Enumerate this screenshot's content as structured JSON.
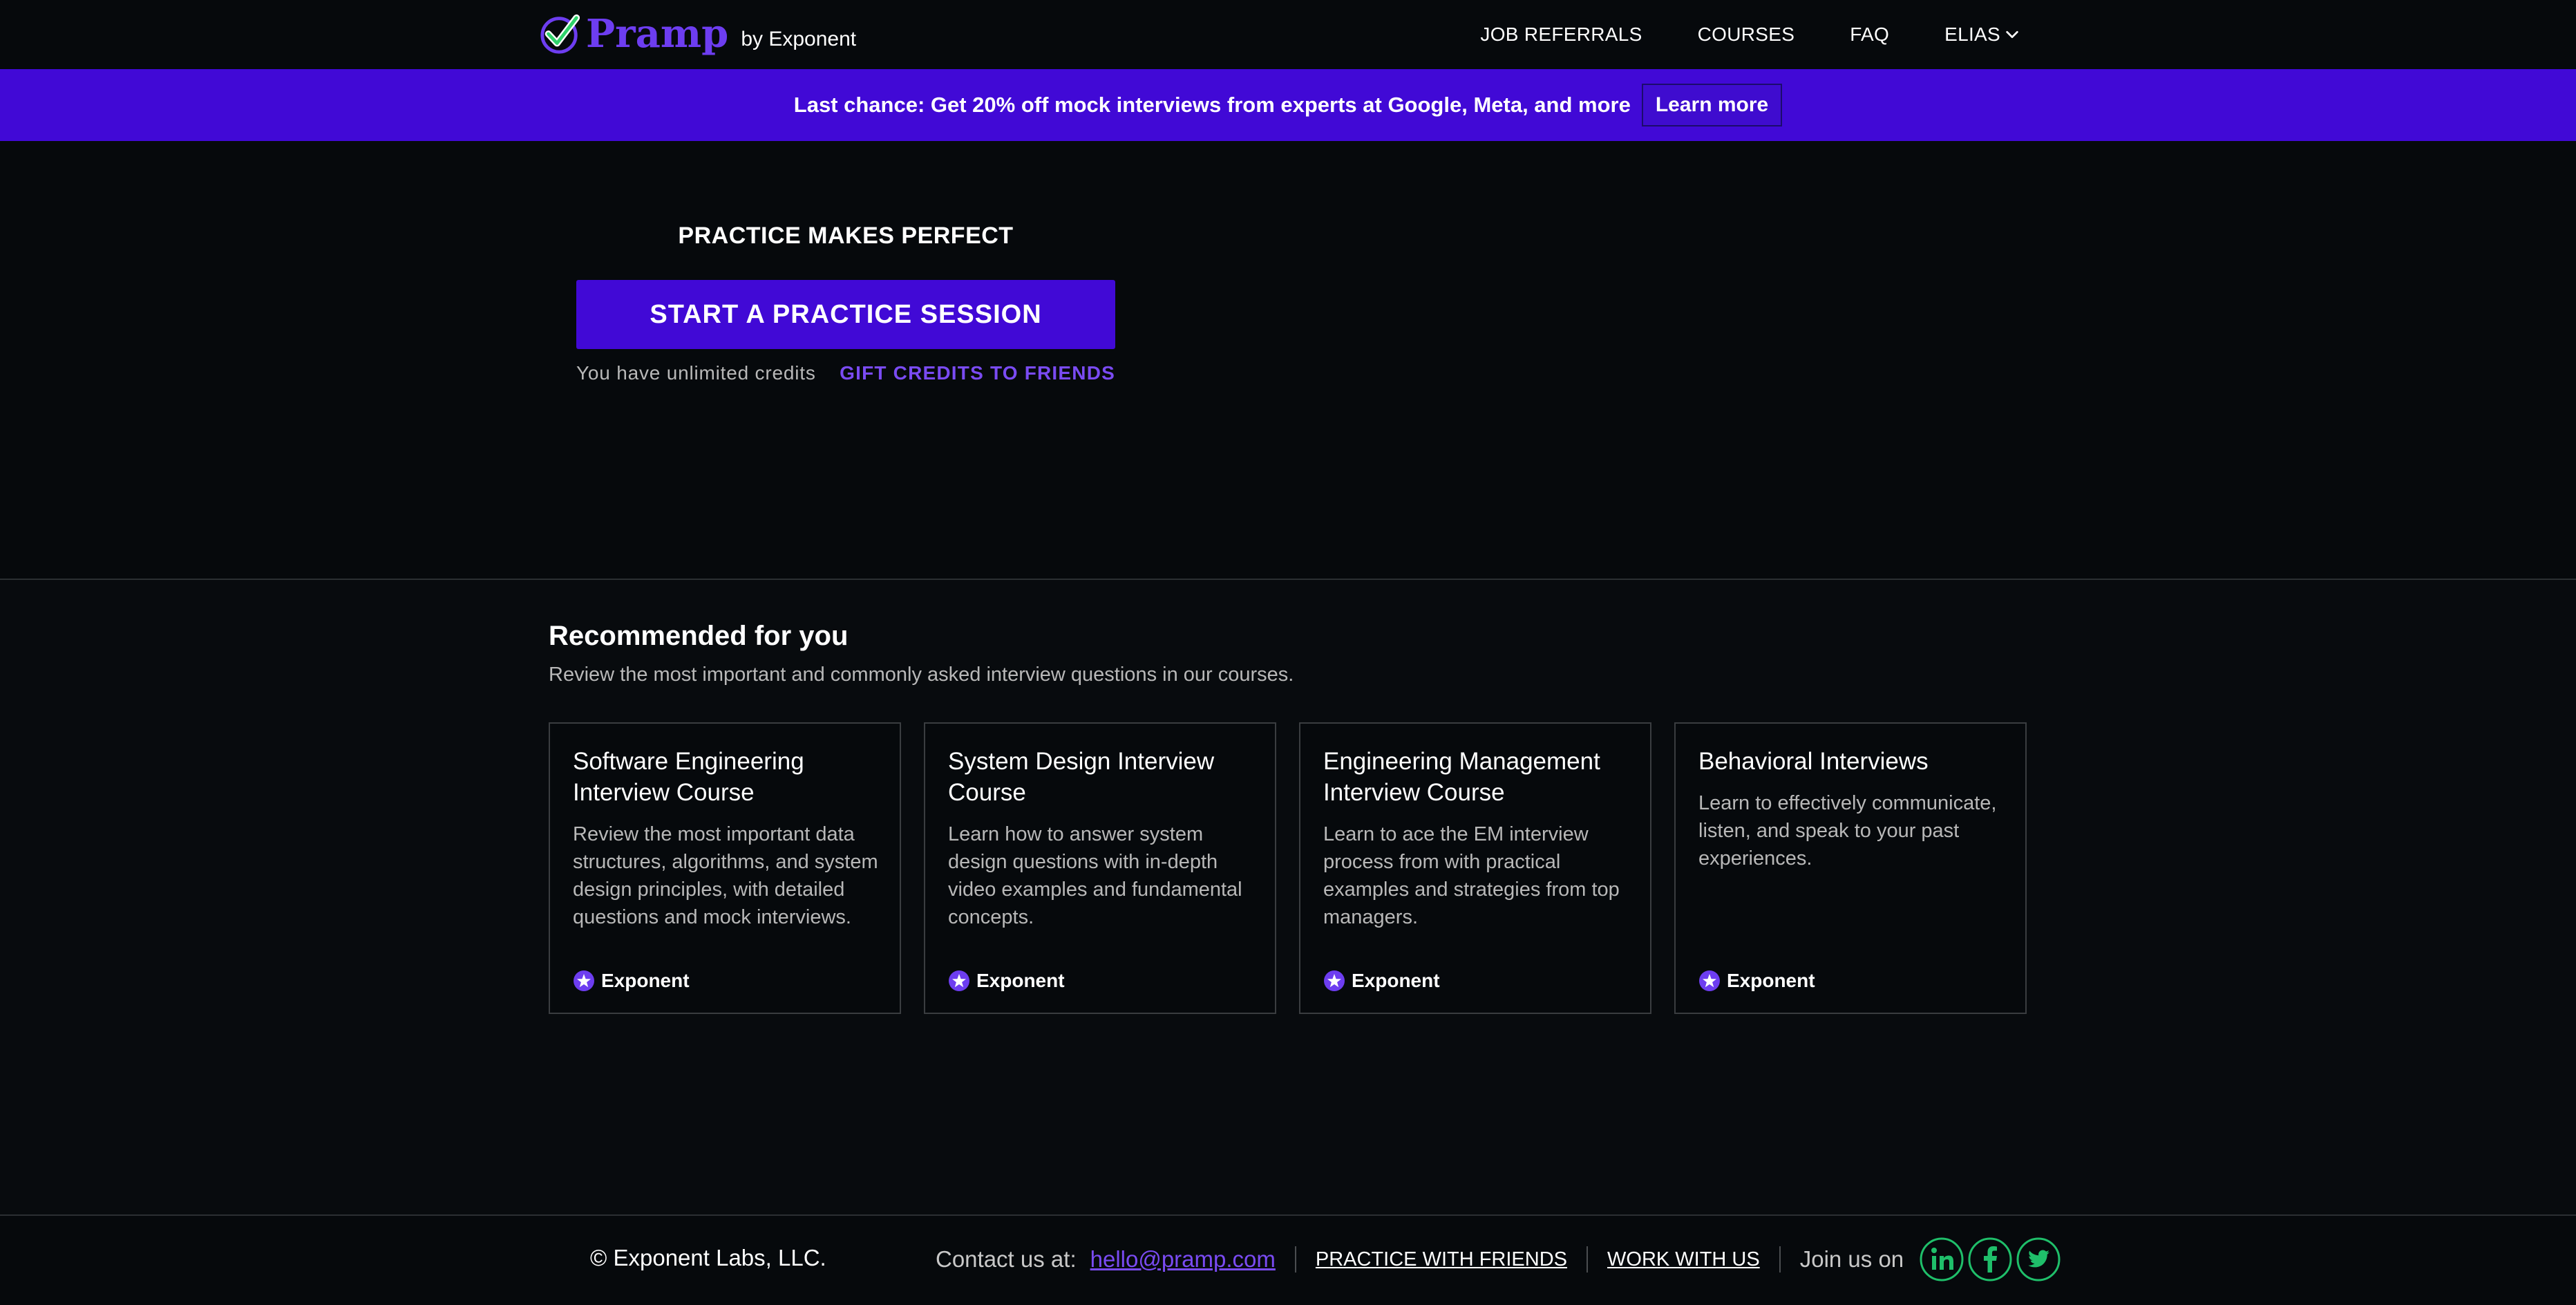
{
  "nav": {
    "logo_word": "Pramp",
    "logo_by": "by Exponent",
    "links": [
      {
        "label": "JOB REFERRALS"
      },
      {
        "label": "COURSES"
      },
      {
        "label": "FAQ"
      },
      {
        "label": "ELIAS"
      }
    ]
  },
  "banner": {
    "text": "Last chance: Get 20% off mock interviews from experts at Google, Meta, and more",
    "button": "Learn more"
  },
  "hero": {
    "title": "PRACTICE MAKES PERFECT",
    "start_button": "START A PRACTICE SESSION",
    "credits": "You have unlimited credits",
    "gift": "GIFT CREDITS TO FRIENDS"
  },
  "recommended": {
    "title": "Recommended for you",
    "subtitle": "Review the most important and commonly asked interview questions in our courses.",
    "cards": [
      {
        "title": "Software Engineering Interview Course",
        "desc": "Review the most important data structures, algorithms, and system design principles, with detailed questions and mock interviews.",
        "brand": "Exponent"
      },
      {
        "title": "System Design Interview Course",
        "desc": "Learn how to answer system design questions with in-depth video examples and fundamental concepts.",
        "brand": "Exponent"
      },
      {
        "title": "Engineering Management Interview Course",
        "desc": "Learn to ace the EM interview process from with practical examples and strategies from top managers.",
        "brand": "Exponent"
      },
      {
        "title": "Behavioral Interviews",
        "desc": "Learn to effectively communicate, listen, and speak to your past experiences.",
        "brand": "Exponent"
      }
    ]
  },
  "footer": {
    "copyright": "© Exponent Labs, LLC.",
    "contact_label": "Contact us at:",
    "email": "hello@pramp.com",
    "practice_link": "PRACTICE WITH FRIENDS",
    "work_link": "WORK WITH US",
    "join": "Join us on"
  },
  "colors": {
    "accent": "#4109d6",
    "link_purple": "#7a4bf3",
    "social_green": "#1fbf6a",
    "background": "#06090c"
  },
  "icons": [
    "checkmark-logo-icon",
    "chevron-down-icon",
    "exponent-star-icon",
    "linkedin-icon",
    "facebook-icon",
    "twitter-icon"
  ]
}
